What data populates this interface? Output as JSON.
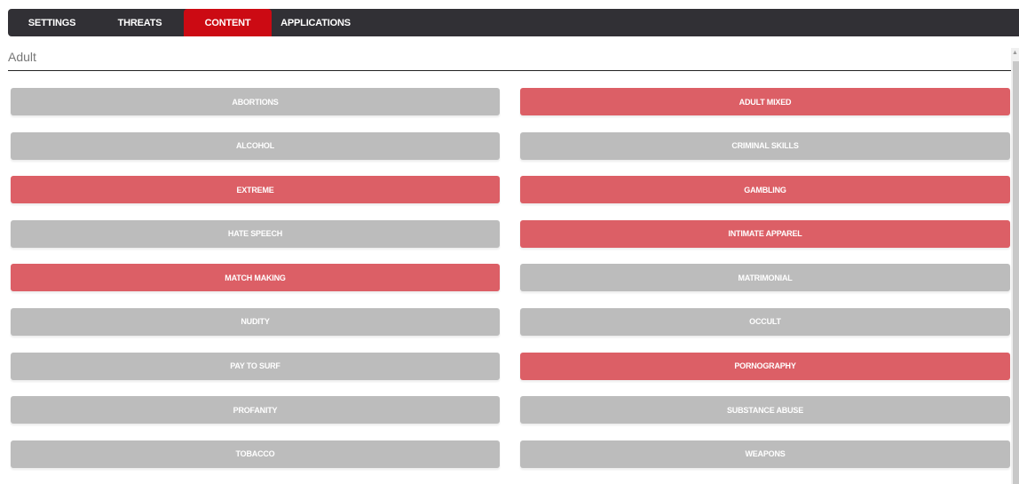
{
  "tabs": [
    {
      "label": "SETTINGS",
      "active": false
    },
    {
      "label": "THREATS",
      "active": false
    },
    {
      "label": "CONTENT",
      "active": true
    },
    {
      "label": "APPLICATIONS",
      "active": false
    }
  ],
  "section": {
    "title": "Adult"
  },
  "colors": {
    "blocked": "#dc5f66",
    "allowed": "#bcbcbc",
    "active_tab": "#cc0a13",
    "tabbar": "#313035"
  },
  "categories": [
    {
      "label": "ABORTIONS",
      "blocked": false
    },
    {
      "label": "ADULT MIXED",
      "blocked": true
    },
    {
      "label": "ALCOHOL",
      "blocked": false
    },
    {
      "label": "CRIMINAL SKILLS",
      "blocked": false
    },
    {
      "label": "EXTREME",
      "blocked": true
    },
    {
      "label": "GAMBLING",
      "blocked": true
    },
    {
      "label": "HATE SPEECH",
      "blocked": false
    },
    {
      "label": "INTIMATE APPAREL",
      "blocked": true
    },
    {
      "label": "MATCH MAKING",
      "blocked": true
    },
    {
      "label": "MATRIMONIAL",
      "blocked": false
    },
    {
      "label": "NUDITY",
      "blocked": false
    },
    {
      "label": "OCCULT",
      "blocked": false
    },
    {
      "label": "PAY TO SURF",
      "blocked": false
    },
    {
      "label": "PORNOGRAPHY",
      "blocked": true
    },
    {
      "label": "PROFANITY",
      "blocked": false
    },
    {
      "label": "SUBSTANCE ABUSE",
      "blocked": false
    },
    {
      "label": "TOBACCO",
      "blocked": false
    },
    {
      "label": "WEAPONS",
      "blocked": false
    }
  ]
}
